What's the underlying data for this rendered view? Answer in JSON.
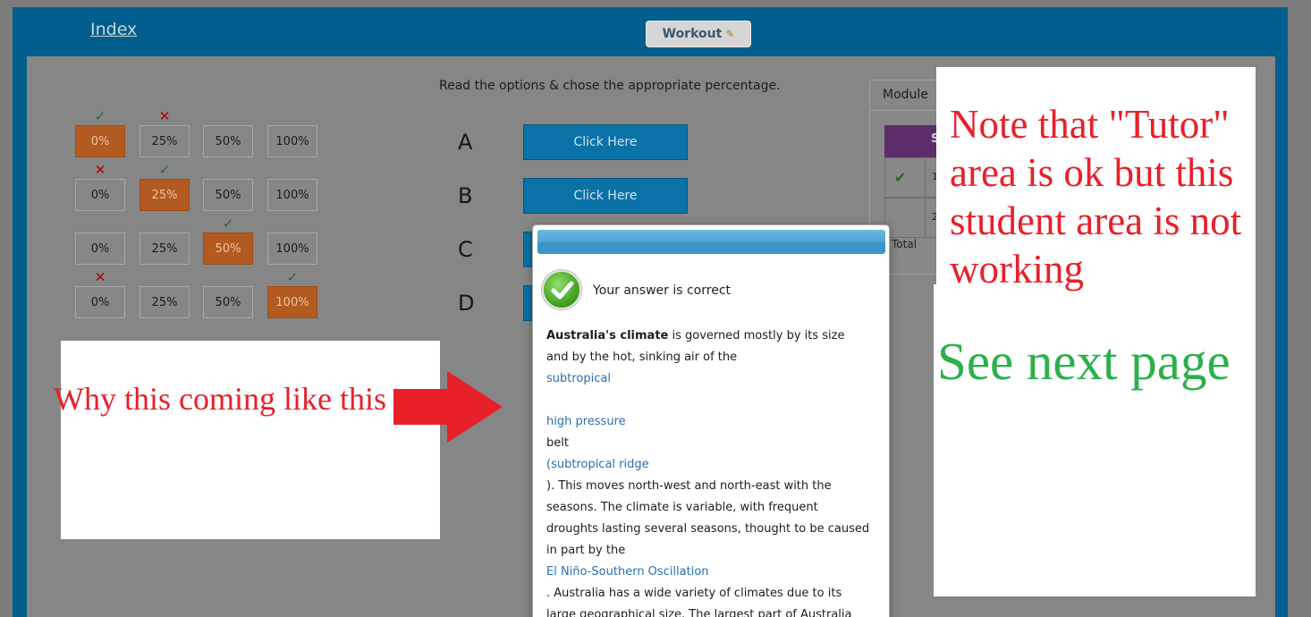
{
  "header": {
    "index_label": "Index",
    "workout_label": "Workout",
    "workout_icon": "edit-icon"
  },
  "instruction": "Read the options & chose the appropriate percentage.",
  "percent_grid": {
    "labels": [
      "0%",
      "25%",
      "50%",
      "100%"
    ],
    "rows": [
      {
        "selected": 0,
        "marks": [
          "check",
          "cross",
          null,
          null
        ]
      },
      {
        "selected": 1,
        "marks": [
          "cross",
          "check",
          null,
          null
        ]
      },
      {
        "selected": 2,
        "marks": [
          null,
          null,
          "check",
          null
        ]
      },
      {
        "selected": 3,
        "marks": [
          "cross",
          null,
          null,
          "check"
        ]
      }
    ]
  },
  "options": [
    {
      "letter": "A",
      "button": "Click Here"
    },
    {
      "letter": "B",
      "button": "Click Here"
    },
    {
      "letter": "C",
      "button": "Click Here"
    },
    {
      "letter": "D",
      "button": "Click Here"
    }
  ],
  "module_panel": {
    "tab_label": "Module",
    "header_text": "S",
    "rows": [
      {
        "num": "1",
        "checked": true
      },
      {
        "num": "2",
        "checked": false
      }
    ],
    "total_label": "Total"
  },
  "popup": {
    "result_text": "Your answer is correct",
    "body_lines": [
      {
        "type": "rich",
        "bold": "Australia's climate",
        "rest": " is governed mostly by its size"
      },
      {
        "type": "text",
        "text": "and by the hot, sinking air of the"
      },
      {
        "type": "link",
        "text": "subtropical"
      },
      {
        "type": "text",
        "text": ""
      },
      {
        "type": "link",
        "text": "high pressure"
      },
      {
        "type": "text",
        "text": " belt"
      },
      {
        "type": "link",
        "text": "(subtropical ridge"
      },
      {
        "type": "text",
        "text": "). This moves north-west and north-east with the"
      },
      {
        "type": "text",
        "text": "seasons. The climate is variable, with frequent"
      },
      {
        "type": "text",
        "text": "droughts lasting several seasons, thought to be caused"
      },
      {
        "type": "text",
        "text": "in part by the"
      },
      {
        "type": "link",
        "text": "El Niño-Southern Oscillation"
      },
      {
        "type": "text",
        "text": ". Australia has a wide variety of climates due to its"
      },
      {
        "type": "text",
        "text": "large geographical size. The largest part of Australia"
      }
    ]
  },
  "annotations": {
    "why_text": "Why this coming like this",
    "note_text": "Note that \"Tutor\" area is ok but this student area is not working",
    "see_next": "See next page",
    "red_color": "#e8202a",
    "green_color": "#2bb04a"
  }
}
